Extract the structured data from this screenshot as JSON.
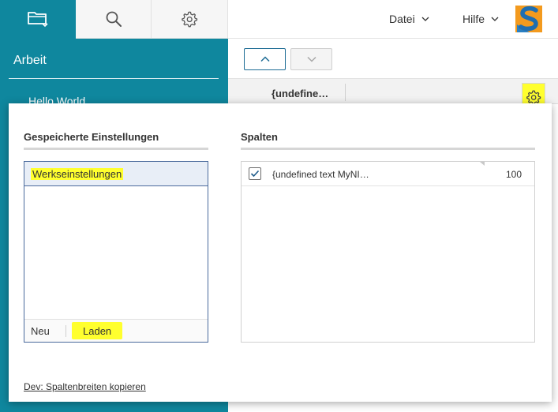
{
  "sidebar": {
    "tabs": [
      {
        "icon": "folder-icon",
        "active": true
      },
      {
        "icon": "search-icon",
        "active": false
      },
      {
        "icon": "gear-icon",
        "active": false
      }
    ],
    "section_title": "Arbeit",
    "items": [
      {
        "label": "Hello World"
      }
    ]
  },
  "topbar": {
    "menus": [
      {
        "label": "Datei",
        "icon": "chevron-down-icon"
      },
      {
        "label": "Hilfe",
        "icon": "chevron-down-icon"
      }
    ],
    "logo_letter": "S"
  },
  "toolbar": {
    "up_icon": "chevron-up-icon",
    "down_icon": "chevron-down-icon"
  },
  "column_header": {
    "label": "{undefine…",
    "settings_icon": "gear-icon"
  },
  "popup": {
    "saved": {
      "title": "Gespeicherte Einstellungen",
      "items": [
        {
          "label": "Werkseinstellungen",
          "selected": true
        }
      ],
      "new_label": "Neu",
      "load_label": "Laden"
    },
    "columns": {
      "title": "Spalten",
      "rows": [
        {
          "label": "{undefined text MyNI…",
          "width": "100",
          "checked": true
        }
      ]
    },
    "dev_link": "Dev: Spaltenbreiten kopieren"
  },
  "colors": {
    "sidebar": "#0f879e",
    "highlight": "#ffff2e",
    "accent_border": "#1c6b94"
  }
}
